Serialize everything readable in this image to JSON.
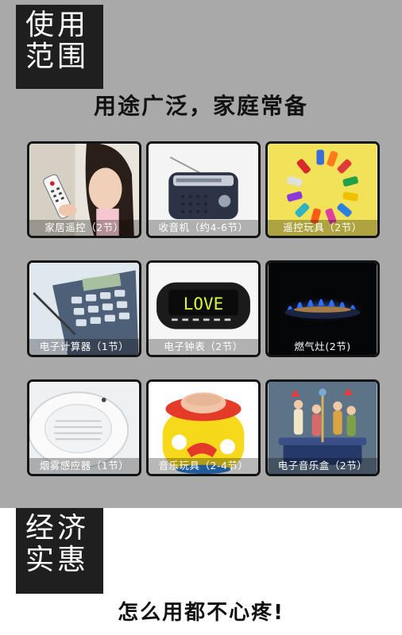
{
  "usage_section": {
    "tag_line1": "使用",
    "tag_line2": "范围",
    "headline": "用途广泛，家庭常备",
    "items": [
      {
        "label": "家居遥控（2节）",
        "icon": "tv-remote-icon"
      },
      {
        "label": "收音机（约4-6节）",
        "icon": "radio-icon"
      },
      {
        "label": "遥控玩具（2节）",
        "icon": "toy-cars-icon"
      },
      {
        "label": "电子计算器（1节）",
        "icon": "calculator-icon"
      },
      {
        "label": "电子钟表（2节）",
        "icon": "alarm-clock-icon",
        "display_text": "LOVE"
      },
      {
        "label": "燃气灶(2节)",
        "icon": "gas-stove-icon"
      },
      {
        "label": "烟雾感应器（1节）",
        "icon": "smoke-detector-icon"
      },
      {
        "label": "音乐玩具（2-4节）",
        "icon": "music-toy-icon"
      },
      {
        "label": "电子音乐盒（2节）",
        "icon": "music-box-icon"
      }
    ]
  },
  "value_section": {
    "tag_line1": "经济",
    "tag_line2": "实惠",
    "headline": "怎么用都不心疼!"
  },
  "colors": {
    "panel_gray": "#a9a9a9",
    "tag_black": "#1f1f1f",
    "tile_border": "#141414",
    "clock_digits": "#d7ff2a",
    "flame_blue": "#2f6dff"
  }
}
